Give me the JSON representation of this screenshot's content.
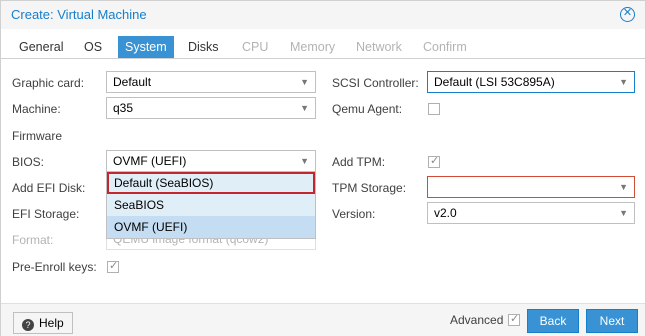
{
  "window": {
    "title": "Create: Virtual Machine"
  },
  "tabs": [
    {
      "label": "General",
      "state": "normal"
    },
    {
      "label": "OS",
      "state": "normal"
    },
    {
      "label": "System",
      "state": "active"
    },
    {
      "label": "Disks",
      "state": "normal"
    },
    {
      "label": "CPU",
      "state": "disabled"
    },
    {
      "label": "Memory",
      "state": "disabled"
    },
    {
      "label": "Network",
      "state": "disabled"
    },
    {
      "label": "Confirm",
      "state": "disabled"
    }
  ],
  "form": {
    "graphic_card": {
      "label": "Graphic card:",
      "value": "Default"
    },
    "machine": {
      "label": "Machine:",
      "value": "q35"
    },
    "firmware_section": "Firmware",
    "bios": {
      "label": "BIOS:",
      "value": "OVMF (UEFI)"
    },
    "add_efi_disk": {
      "label": "Add EFI Disk:"
    },
    "efi_storage": {
      "label": "EFI Storage:"
    },
    "format": {
      "label": "Format:",
      "value": "QEMU image format (qcow2)"
    },
    "pre_enroll": {
      "label": "Pre-Enroll keys:",
      "checked": true
    },
    "scsi_controller": {
      "label": "SCSI Controller:",
      "value": "Default (LSI 53C895A)"
    },
    "qemu_agent": {
      "label": "Qemu Agent:",
      "checked": false
    },
    "add_tpm": {
      "label": "Add TPM:",
      "checked": true
    },
    "tpm_storage": {
      "label": "TPM Storage:",
      "value": ""
    },
    "version": {
      "label": "Version:",
      "value": "v2.0"
    }
  },
  "bios_dropdown": {
    "options": [
      "Default (SeaBIOS)",
      "SeaBIOS",
      "OVMF (UEFI)"
    ],
    "hovered": "Default (SeaBIOS)",
    "selected": "OVMF (UEFI)"
  },
  "footer": {
    "help_label": "Help",
    "advanced_label": "Advanced",
    "advanced_checked": true,
    "back_label": "Back",
    "next_label": "Next"
  },
  "colors": {
    "accent": "#157fcc",
    "active_tab": "#3892d4",
    "invalid": "#cf4c35",
    "hover_outline": "#c1272d"
  }
}
